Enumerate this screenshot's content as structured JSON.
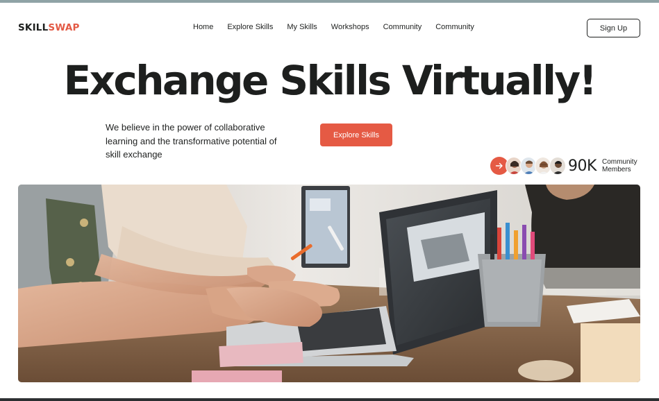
{
  "brand": {
    "part1": "SKILL",
    "part2": "SWAP",
    "accent_color": "#e55a44"
  },
  "nav": {
    "items": [
      {
        "label": "Home"
      },
      {
        "label": "Explore Skills"
      },
      {
        "label": "My Skills"
      },
      {
        "label": "Workshops"
      },
      {
        "label": "Community"
      },
      {
        "label": "Community"
      }
    ],
    "signup_label": "Sign Up"
  },
  "hero": {
    "headline": "Exchange Skills Virtually!",
    "tagline": "We believe in the power of collaborative learning and the transformative potential of skill exchange",
    "cta_label": "Explore Skills"
  },
  "community": {
    "arrow_icon": "arrow-right-icon",
    "count": "90K",
    "label_line1": "Community",
    "label_line2": "Members"
  },
  "photo": {
    "icon": "people-using-laptop-image"
  }
}
